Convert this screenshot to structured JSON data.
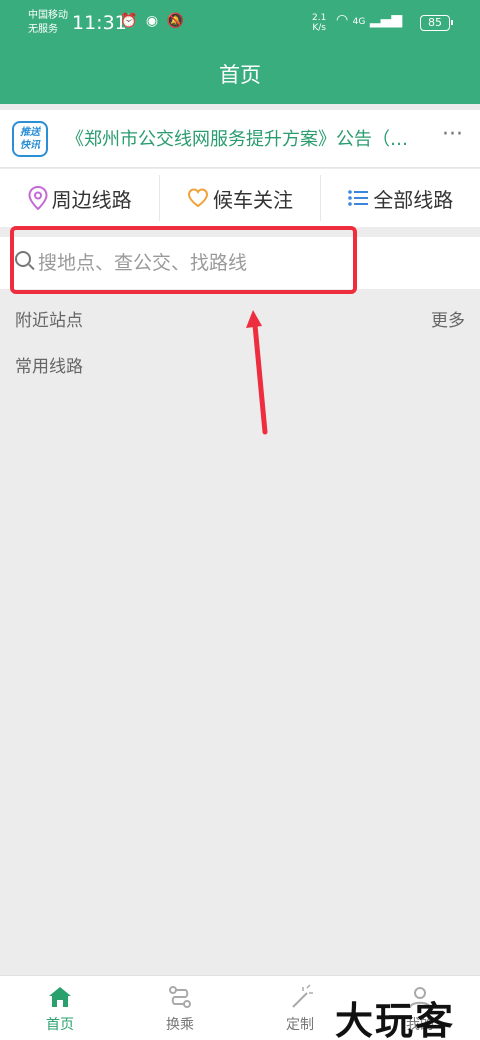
{
  "status_bar": {
    "carrier": "中国移动",
    "service": "无服务",
    "time": "11:31",
    "net_speed_value": "2.1",
    "net_speed_unit": "K/s",
    "network": "4G",
    "battery": "85",
    "icons": [
      "alarm-icon",
      "location-icon",
      "mute-icon",
      "wifi-icon",
      "signal-icon"
    ]
  },
  "header": {
    "title": "首页"
  },
  "notice": {
    "logo_line1": "推送",
    "logo_line2": "快讯",
    "text": "《郑州市公交线网服务提升方案》公告（…",
    "more": "···"
  },
  "quick_nav": [
    {
      "label": "周边线路",
      "icon": "location-pin-icon"
    },
    {
      "label": "候车关注",
      "icon": "heart-icon"
    },
    {
      "label": "全部线路",
      "icon": "list-icon"
    }
  ],
  "search": {
    "placeholder": "搜地点、查公交、找路线",
    "value": ""
  },
  "sections": {
    "nearby_stops": "附近站点",
    "more": "更多",
    "common_routes": "常用线路"
  },
  "tabs": [
    {
      "label": "首页",
      "icon": "home-icon",
      "active": true
    },
    {
      "label": "换乘",
      "icon": "transfer-icon",
      "active": false
    },
    {
      "label": "定制",
      "icon": "magic-wand-icon",
      "active": false
    },
    {
      "label": "我的",
      "icon": "profile-icon",
      "active": false
    }
  ],
  "watermark": "大玩客",
  "colors": {
    "brand_green": "#3aad7e",
    "notice_green": "#2a9c6e",
    "highlight_red": "#ee2e3f",
    "background": "#ececec"
  }
}
